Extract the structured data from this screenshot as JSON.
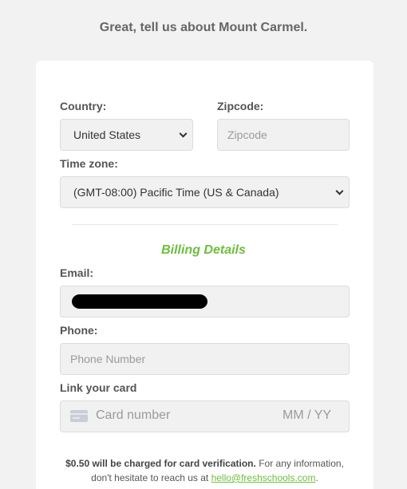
{
  "heading": "Great, tell us about Mount Carmel.",
  "form": {
    "country_label": "Country:",
    "country_value": "United States",
    "zipcode_label": "Zipcode:",
    "zipcode_placeholder": "Zipcode",
    "timezone_label": "Time zone:",
    "timezone_value": "(GMT-08:00) Pacific Time (US & Canada)"
  },
  "billing": {
    "title": "Billing Details",
    "email_label": "Email:",
    "email_value": "[redacted]",
    "phone_label": "Phone:",
    "phone_placeholder": "Phone Number",
    "card_label": "Link your card",
    "card_number_placeholder": "Card number",
    "card_expiry_placeholder": "MM / YY"
  },
  "footnote": {
    "bold": "$0.50 will be charged for card verification.",
    "text1": " For any information, don't hesitate to reach us at ",
    "email_link": "hello@freshschools.com",
    "text2": "."
  },
  "colors": {
    "accent": "#6cbf3c",
    "background": "#f2f2f2",
    "field_bg": "#f1f1f1"
  }
}
